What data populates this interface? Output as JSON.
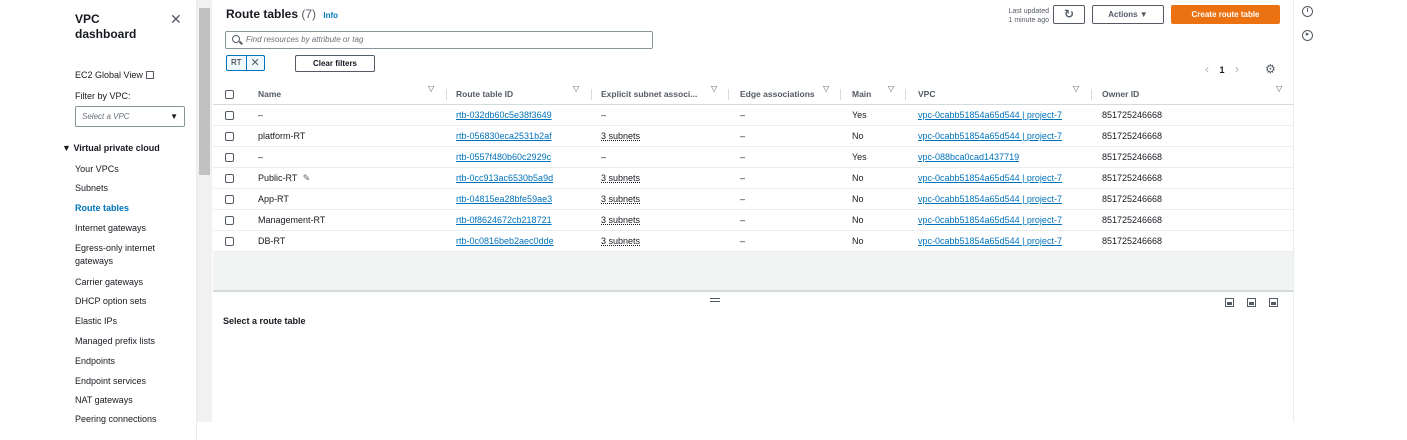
{
  "nav": {
    "title_line1": "VPC",
    "title_line2": "dashboard",
    "close": "✕",
    "global_view": "EC2 Global View",
    "filter_label": "Filter by VPC:",
    "filter_placeholder": "Select a VPC",
    "section": "Virtual private cloud",
    "items": [
      "Your VPCs",
      "Subnets",
      "Route tables",
      "Internet gateways",
      "Egress-only internet",
      "gateways",
      "Carrier gateways",
      "DHCP option sets",
      "Elastic IPs",
      "Managed prefix lists",
      "Endpoints",
      "Endpoint services",
      "NAT gateways",
      "Peering connections"
    ],
    "active_item": "Route tables"
  },
  "header": {
    "title": "Route tables",
    "count": "(7)",
    "info": "Info",
    "last_updated_1": "Last updated",
    "last_updated_2": "1 minute ago",
    "refresh_icon": "↻",
    "actions": "Actions ▼",
    "create": "Create route table"
  },
  "search": {
    "placeholder": "Find resources by attribute or tag"
  },
  "filter": {
    "token": "RT",
    "token_remove": "✕",
    "clear": "Clear filters"
  },
  "pager": {
    "prev": "‹",
    "page": "1",
    "next": "›",
    "settings_icon": "⚙"
  },
  "table": {
    "columns": [
      "Name",
      "Route table ID",
      "Explicit subnet associ...",
      "Edge associations",
      "Main",
      "VPC",
      "Owner ID"
    ],
    "rows": [
      {
        "name": "–",
        "id": "rtb-032db60c5e38f3649",
        "subnets": "–",
        "edge": "–",
        "main": "Yes",
        "vpc": "vpc-0cabb51854a65d544 | project-7",
        "owner": "851725246668"
      },
      {
        "name": "platform-RT",
        "id": "rtb-056830eca2531b2af",
        "subnets": "3 subnets",
        "edge": "–",
        "main": "No",
        "vpc": "vpc-0cabb51854a65d544 | project-7",
        "owner": "851725246668"
      },
      {
        "name": "–",
        "id": "rtb-0557f480b60c2929c",
        "subnets": "–",
        "edge": "–",
        "main": "Yes",
        "vpc": "vpc-088bca0cad1437719",
        "owner": "851725246668"
      },
      {
        "name": "Public-RT",
        "id": "rtb-0cc913ac6530b5a9d",
        "subnets": "3 subnets",
        "edge": "–",
        "main": "No",
        "vpc": "vpc-0cabb51854a65d544 | project-7",
        "owner": "851725246668"
      },
      {
        "name": "App-RT",
        "id": "rtb-04815ea28bfe59ae3",
        "subnets": "3 subnets",
        "edge": "–",
        "main": "No",
        "vpc": "vpc-0cabb51854a65d544 | project-7",
        "owner": "851725246668"
      },
      {
        "name": "Management-RT",
        "id": "rtb-0f8624672cb218721",
        "subnets": "3 subnets",
        "edge": "–",
        "main": "No",
        "vpc": "vpc-0cabb51854a65d544 | project-7",
        "owner": "851725246668"
      },
      {
        "name": "DB-RT",
        "id": "rtb-0c0816beb2aec0dde",
        "subnets": "3 subnets",
        "edge": "–",
        "main": "No",
        "vpc": "vpc-0cabb51854a65d544 | project-7",
        "owner": "851725246668"
      }
    ]
  },
  "split": {
    "title": "Select a route table"
  },
  "colors": {
    "link": "#0073bb",
    "primary": "#ec7211",
    "text": "#16191f"
  }
}
